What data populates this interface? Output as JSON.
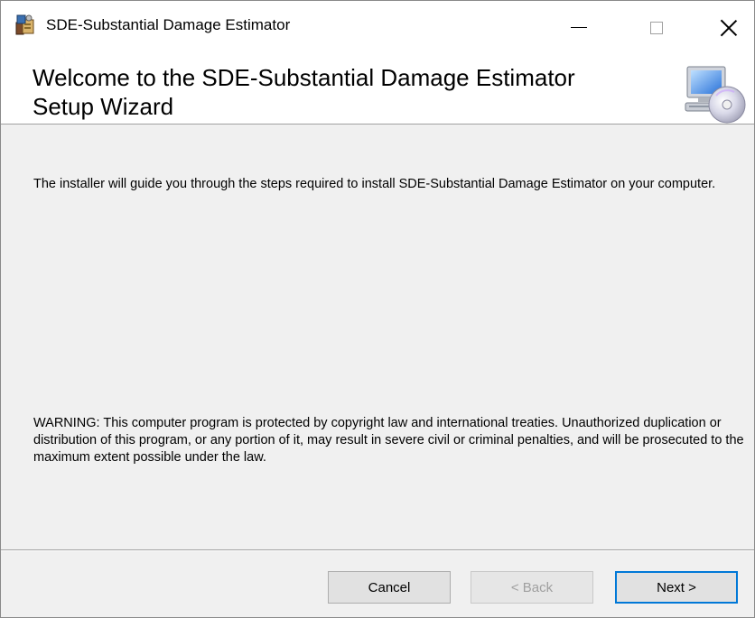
{
  "window": {
    "title": "SDE-Substantial Damage Estimator"
  },
  "banner": {
    "title": "Welcome to the SDE-Substantial Damage Estimator Setup Wizard"
  },
  "content": {
    "intro": "The installer will guide you through the steps required to install SDE-Substantial Damage Estimator on your computer.",
    "warning": "WARNING: This computer program is protected by copyright law and international treaties. Unauthorized duplication or distribution of this program, or any portion of it, may result in severe civil or criminal penalties, and will be prosecuted to the maximum extent possible under the law."
  },
  "buttons": {
    "cancel": "Cancel",
    "back": "< Back",
    "next": "Next >"
  },
  "colors": {
    "accent": "#0078d7",
    "background": "#f0f0f0",
    "header": "#ffffff"
  },
  "icons": {
    "app": "installer-package-icon",
    "banner": "computer-cd-icon"
  }
}
